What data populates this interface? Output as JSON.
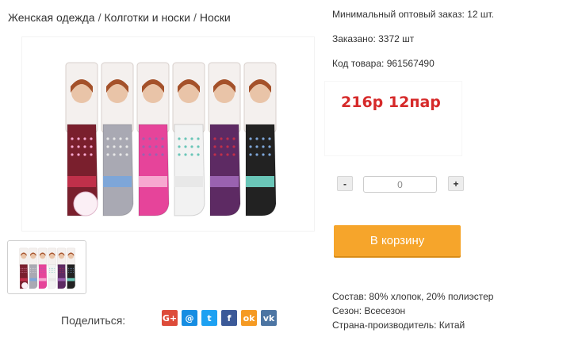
{
  "breadcrumb": {
    "items": [
      "Женская одежда",
      "Колготки и носки",
      "Носки"
    ],
    "separator": "/"
  },
  "product": {
    "min_order": "Минимальный оптовый заказ: 12 шт.",
    "ordered": "Заказано: 3372 шт",
    "code": "Код товара: 961567490",
    "price": "216р 12пар"
  },
  "quantity": {
    "minus": "-",
    "plus": "+",
    "value": "0"
  },
  "cart": {
    "label": "В корзину"
  },
  "specs": {
    "composition": "Состав: 80% хлопок, 20% полиэстер",
    "season": "Сезон: Всесезон",
    "country": "Страна-производитель: Китай"
  },
  "share": {
    "label": "Поделиться:",
    "icons": [
      {
        "name": "google-plus",
        "glyph": "G+",
        "color": "#dd4b39"
      },
      {
        "name": "mail",
        "glyph": "@",
        "color": "#168de2"
      },
      {
        "name": "twitter",
        "glyph": "t",
        "color": "#1da1f2"
      },
      {
        "name": "facebook",
        "glyph": "f",
        "color": "#3b5998"
      },
      {
        "name": "odnoklassniki",
        "glyph": "ok",
        "color": "#f59a23"
      },
      {
        "name": "vkontakte",
        "glyph": "vk",
        "color": "#4c75a3"
      }
    ]
  },
  "colors": {
    "price": "#d62a2a",
    "cart_button": "#f6a52b",
    "sock_colors": [
      "#7a1f2d",
      "#a9a9b3",
      "#e6449a",
      "#f2f2f2",
      "#5d2a63",
      "#222222"
    ]
  }
}
